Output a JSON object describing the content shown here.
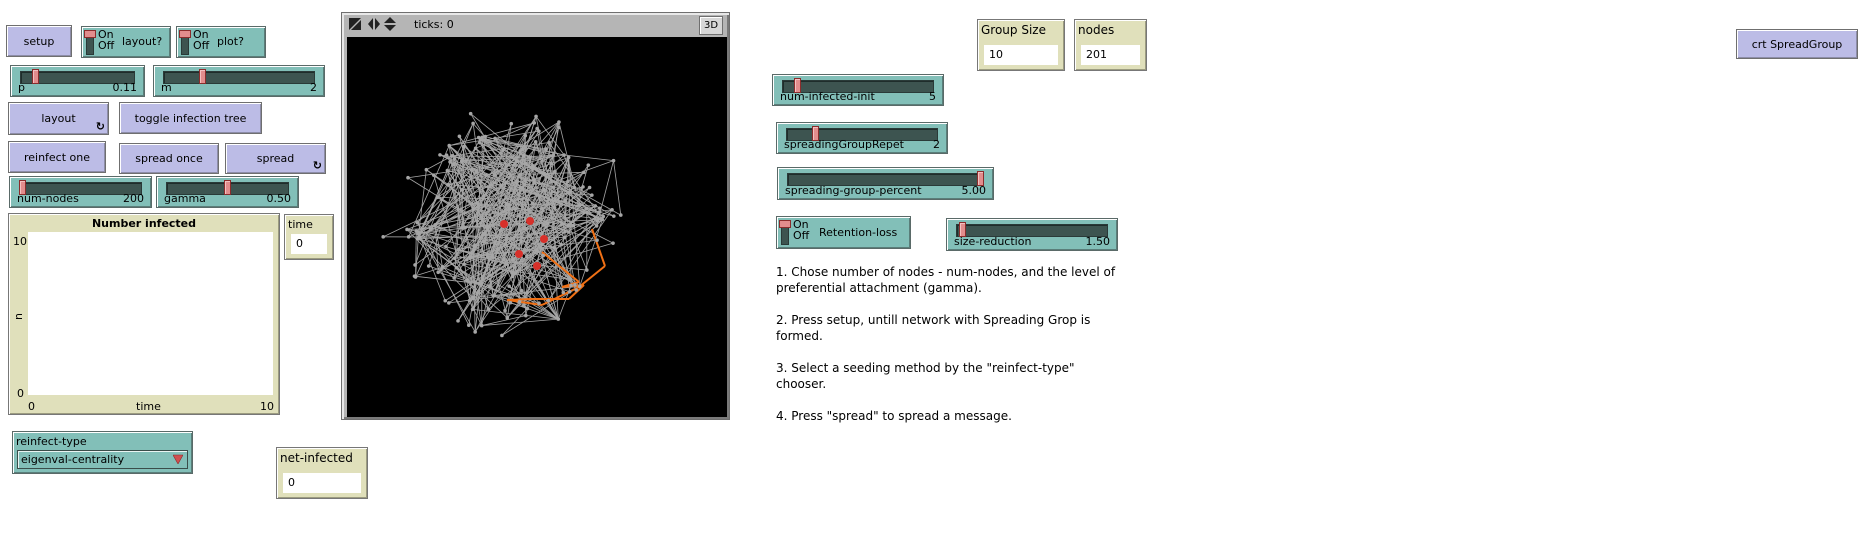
{
  "buttons": {
    "setup": "setup",
    "layout": "layout",
    "toggle_tree": "toggle infection tree",
    "reinfect_one": "reinfect one",
    "spread_once": "spread once",
    "spread": "spread",
    "crt_spreadgroup": "crt SpreadGroup",
    "forever_icon": "↻"
  },
  "switches": {
    "layout": {
      "name": "layout?",
      "on": "On",
      "off": "Off",
      "state": "on"
    },
    "plot": {
      "name": "plot?",
      "on": "On",
      "off": "Off",
      "state": "on"
    },
    "retention_loss": {
      "name": "Retention-loss",
      "on": "On",
      "off": "Off",
      "state": "on"
    }
  },
  "sliders": {
    "p": {
      "label": "p",
      "value": "0.11",
      "fraction": 0.11
    },
    "m": {
      "label": "m",
      "value": "2",
      "fraction": 0.25
    },
    "num_nodes": {
      "label": "num-nodes",
      "value": "200",
      "fraction": 0.0
    },
    "gamma": {
      "label": "gamma",
      "value": "0.50",
      "fraction": 0.5
    },
    "num_infected_init": {
      "label": "num-infected-init",
      "value": "5",
      "fraction": 0.08
    },
    "spreading_group_repet": {
      "label": "spreadingGroupRepet",
      "value": "2",
      "fraction": 0.18
    },
    "spreading_group_percent": {
      "label": "spreading-group-percent",
      "value": "5.00",
      "fraction": 1.0
    },
    "size_reduction": {
      "label": "size-reduction",
      "value": "1.50",
      "fraction": 0.02
    }
  },
  "plot": {
    "title": "Number infected",
    "ylabel": "n",
    "xlabel": "time",
    "ymax": "10",
    "ymin": "0",
    "xmin": "0",
    "xmax": "10"
  },
  "monitors": {
    "time": {
      "label": "time",
      "value": "0"
    },
    "net_infected": {
      "label": "net-infected",
      "value": "0"
    },
    "group_size": {
      "label": "Group Size",
      "value": "10"
    },
    "nodes": {
      "label": "nodes",
      "value": "201"
    }
  },
  "chooser": {
    "label": "reinfect-type",
    "value": "eigenval-centrality"
  },
  "view": {
    "ticks_label": "ticks: 0",
    "threed_label": "3D",
    "background": "#000000",
    "link_color": "#a6a6a6",
    "node_color": "#a6a6a6",
    "infected_node_color": "#d7302a",
    "tree_link_color": "#f07015"
  },
  "notes": [
    "1. Chose number of nodes - num-nodes, and the level of preferential attachment (gamma).",
    "2. Press setup, untill network with Spreading Grop is formed.",
    "3. Select a seeding method by the \"reinfect-type\" chooser.",
    "4. Press \"spread\" to spread a message."
  ]
}
